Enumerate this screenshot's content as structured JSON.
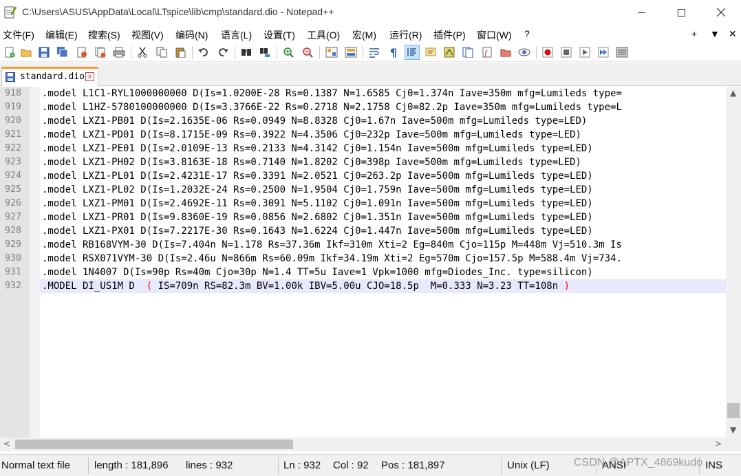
{
  "window": {
    "title": "C:\\Users\\ASUS\\AppData\\Local\\LTspice\\lib\\cmp\\standard.dio - Notepad++"
  },
  "menubar": {
    "items": [
      "文件(F)",
      "编辑(E)",
      "搜索(S)",
      "视图(V)",
      "编码(N)",
      "语言(L)",
      "设置(T)",
      "工具(O)",
      "宏(M)",
      "运行(R)",
      "插件(P)",
      "窗口(W)",
      "?"
    ],
    "right": [
      "+",
      "▼",
      "✕"
    ]
  },
  "toolbar": {
    "icons": [
      "new-file-icon",
      "open-file-icon",
      "save-icon",
      "save-all-icon",
      "close-icon",
      "close-all-icon",
      "print-icon",
      "cut-icon",
      "copy-icon",
      "paste-icon",
      "undo-icon",
      "redo-icon",
      "find-icon",
      "replace-icon",
      "zoom-in-icon",
      "zoom-out-icon",
      "sync-vertical-icon",
      "sync-horizontal-icon",
      "word-wrap-icon",
      "show-all-chars-icon",
      "indent-guide-icon",
      "udl-icon",
      "doc-map-icon",
      "doc-list-icon",
      "function-list-icon",
      "folder-workspace-icon",
      "monitoring-icon",
      "record-macro-icon",
      "stop-macro-icon",
      "play-macro-icon",
      "run-macro-multiple-icon",
      "save-macro-icon"
    ],
    "active": "indent-guide-icon"
  },
  "tab": {
    "label": "standard.dio",
    "close": "x"
  },
  "editor": {
    "lines": [
      {
        "num": "918",
        "text": ".model L1C1-RYL1000000000 D(Is=1.0200E-28 Rs=0.1387 N=1.6585 Cj0=1.374n Iave=350m mfg=Lumileds type="
      },
      {
        "num": "919",
        "text": ".model L1HZ-5780100000000 D(Is=3.3766E-22 Rs=0.2718 N=2.1758 Cj0=82.2p Iave=350m mfg=Lumileds type=L"
      },
      {
        "num": "920",
        "text": ".model LXZ1-PB01 D(Is=2.1635E-06 Rs=0.0949 N=8.8328 Cj0=1.67n Iave=500m mfg=Lumileds type=LED)"
      },
      {
        "num": "921",
        "text": ".model LXZ1-PD01 D(Is=8.1715E-09 Rs=0.3922 N=4.3506 Cj0=232p Iave=500m mfg=Lumileds type=LED)"
      },
      {
        "num": "922",
        "text": ".model LXZ1-PE01 D(Is=2.0109E-13 Rs=0.2133 N=4.3142 Cj0=1.154n Iave=500m mfg=Lumileds type=LED)"
      },
      {
        "num": "923",
        "text": ".model LXZ1-PH02 D(Is=3.8163E-18 Rs=0.7140 N=1.8202 Cj0=398p Iave=500m mfg=Lumileds type=LED)"
      },
      {
        "num": "924",
        "text": ".model LXZ1-PL01 D(Is=2.4231E-17 Rs=0.3391 N=2.0521 Cj0=263.2p Iave=500m mfg=Lumileds type=LED)"
      },
      {
        "num": "925",
        "text": ".model LXZ1-PL02 D(Is=1.2032E-24 Rs=0.2500 N=1.9504 Cj0=1.759n Iave=500m mfg=Lumileds type=LED)"
      },
      {
        "num": "926",
        "text": ".model LXZ1-PM01 D(Is=2.4692E-11 Rs=0.3091 N=5.1102 Cj0=1.091n Iave=500m mfg=Lumileds type=LED)"
      },
      {
        "num": "927",
        "text": ".model LXZ1-PR01 D(Is=9.8360E-19 Rs=0.0856 N=2.6802 Cj0=1.351n Iave=500m mfg=Lumileds type=LED)"
      },
      {
        "num": "928",
        "text": ".model LXZ1-PX01 D(Is=7.2217E-30 Rs=0.1643 N=1.6224 Cj0=1.447n Iave=500m mfg=Lumileds type=LED)"
      },
      {
        "num": "929",
        "text": ".model RB168VYM-30 D(Is=7.404n N=1.178 Rs=37.36m Ikf=310m Xti=2 Eg=840m Cjo=115p M=448m Vj=510.3m Is"
      },
      {
        "num": "930",
        "text": ".model RSX071VYM-30 D(Is=2.46u N=866m Rs=60.09m Ikf=34.19m Xti=2 Eg=570m Cjo=157.5p M=588.4m Vj=734."
      },
      {
        "num": "931",
        "text": ".model 1N4007 D(Is=90p Rs=40m Cjo=30p N=1.4 TT=5u Iave=1 Vpk=1000 mfg=Diodes_Inc. type=silicon)"
      }
    ],
    "current_line": {
      "num": "932",
      "prefix": ".MODEL DI_US1M D  ",
      "open": "(",
      "body": " IS=709n RS=82.3m BV=1.00k IBV=5.00u CJO=18.5p  M=0.333 N=3.23 TT=108n ",
      "close": ")"
    }
  },
  "statusbar": {
    "type": "Normal text file",
    "length": "length : 181,896",
    "lines": "lines : 932",
    "ln": "Ln : 932",
    "col": "Col : 92",
    "pos": "Pos : 181,897",
    "eol": "Unix (LF)",
    "encoding": "ANSI",
    "mode": "INS"
  },
  "watermark": "CSDN @APTX_4869kudo"
}
